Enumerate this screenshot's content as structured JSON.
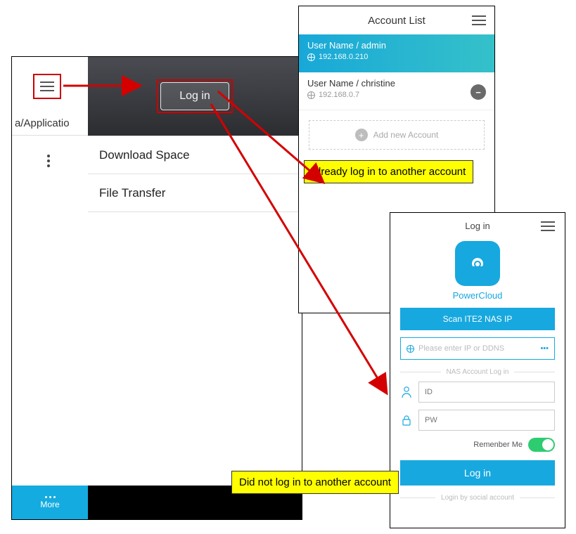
{
  "screen1": {
    "cut_label": "a/Applicatio",
    "login_button": "Log in",
    "items": [
      "Download Space",
      "File Transfer"
    ],
    "more_label": "More"
  },
  "screen2": {
    "title": "Account List",
    "accounts": [
      {
        "name": "User Name / admin",
        "ip": "192.168.0.210"
      },
      {
        "name": "User Name / christine",
        "ip": "192.168.0.7"
      }
    ],
    "add_label": "Add new Account"
  },
  "screen3": {
    "title": "Log in",
    "app_name": "PowerCloud",
    "scan_label": "Scan ITE2 NAS IP",
    "ip_placeholder": "Please enter IP or DDNS",
    "section_label": "NAS Account Log in",
    "id_placeholder": "ID",
    "pw_placeholder": "PW",
    "remember_label": "Remenber Me",
    "login_label": "Log in",
    "social_label": "Login by social account"
  },
  "callouts": {
    "already": "Already log in to another account",
    "didnot": "Did not log in to another account"
  }
}
